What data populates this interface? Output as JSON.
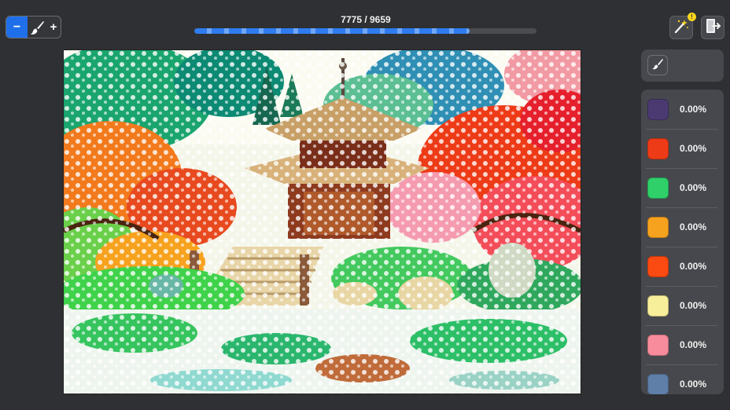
{
  "toolbar": {
    "minus_label": "−",
    "plus_label": "+",
    "brush_icon": "brush-icon"
  },
  "progress": {
    "text": "7775 / 9659",
    "filled": 7775,
    "total": 9659
  },
  "top_right": {
    "hint_icon": "magic-wand-icon",
    "hint_badge": "!",
    "exit_icon": "exit-door-icon"
  },
  "eraser": {
    "icon": "eraser-icon"
  },
  "palette": [
    {
      "color": "#4b3a72",
      "percent": "0.00%"
    },
    {
      "color": "#ee3b17",
      "percent": "0.00%"
    },
    {
      "color": "#2fd06a",
      "percent": "0.00%"
    },
    {
      "color": "#f7a21e",
      "percent": "0.00%"
    },
    {
      "color": "#fb4a12",
      "percent": "0.00%"
    },
    {
      "color": "#f8ef9b",
      "percent": "0.00%"
    },
    {
      "color": "#f88c9c",
      "percent": "0.00%"
    },
    {
      "color": "#5f7ea8",
      "percent": "0.00%"
    }
  ],
  "colors": {
    "accent": "#1f6fea",
    "background": "#2f3033",
    "panel": "#46484d"
  }
}
